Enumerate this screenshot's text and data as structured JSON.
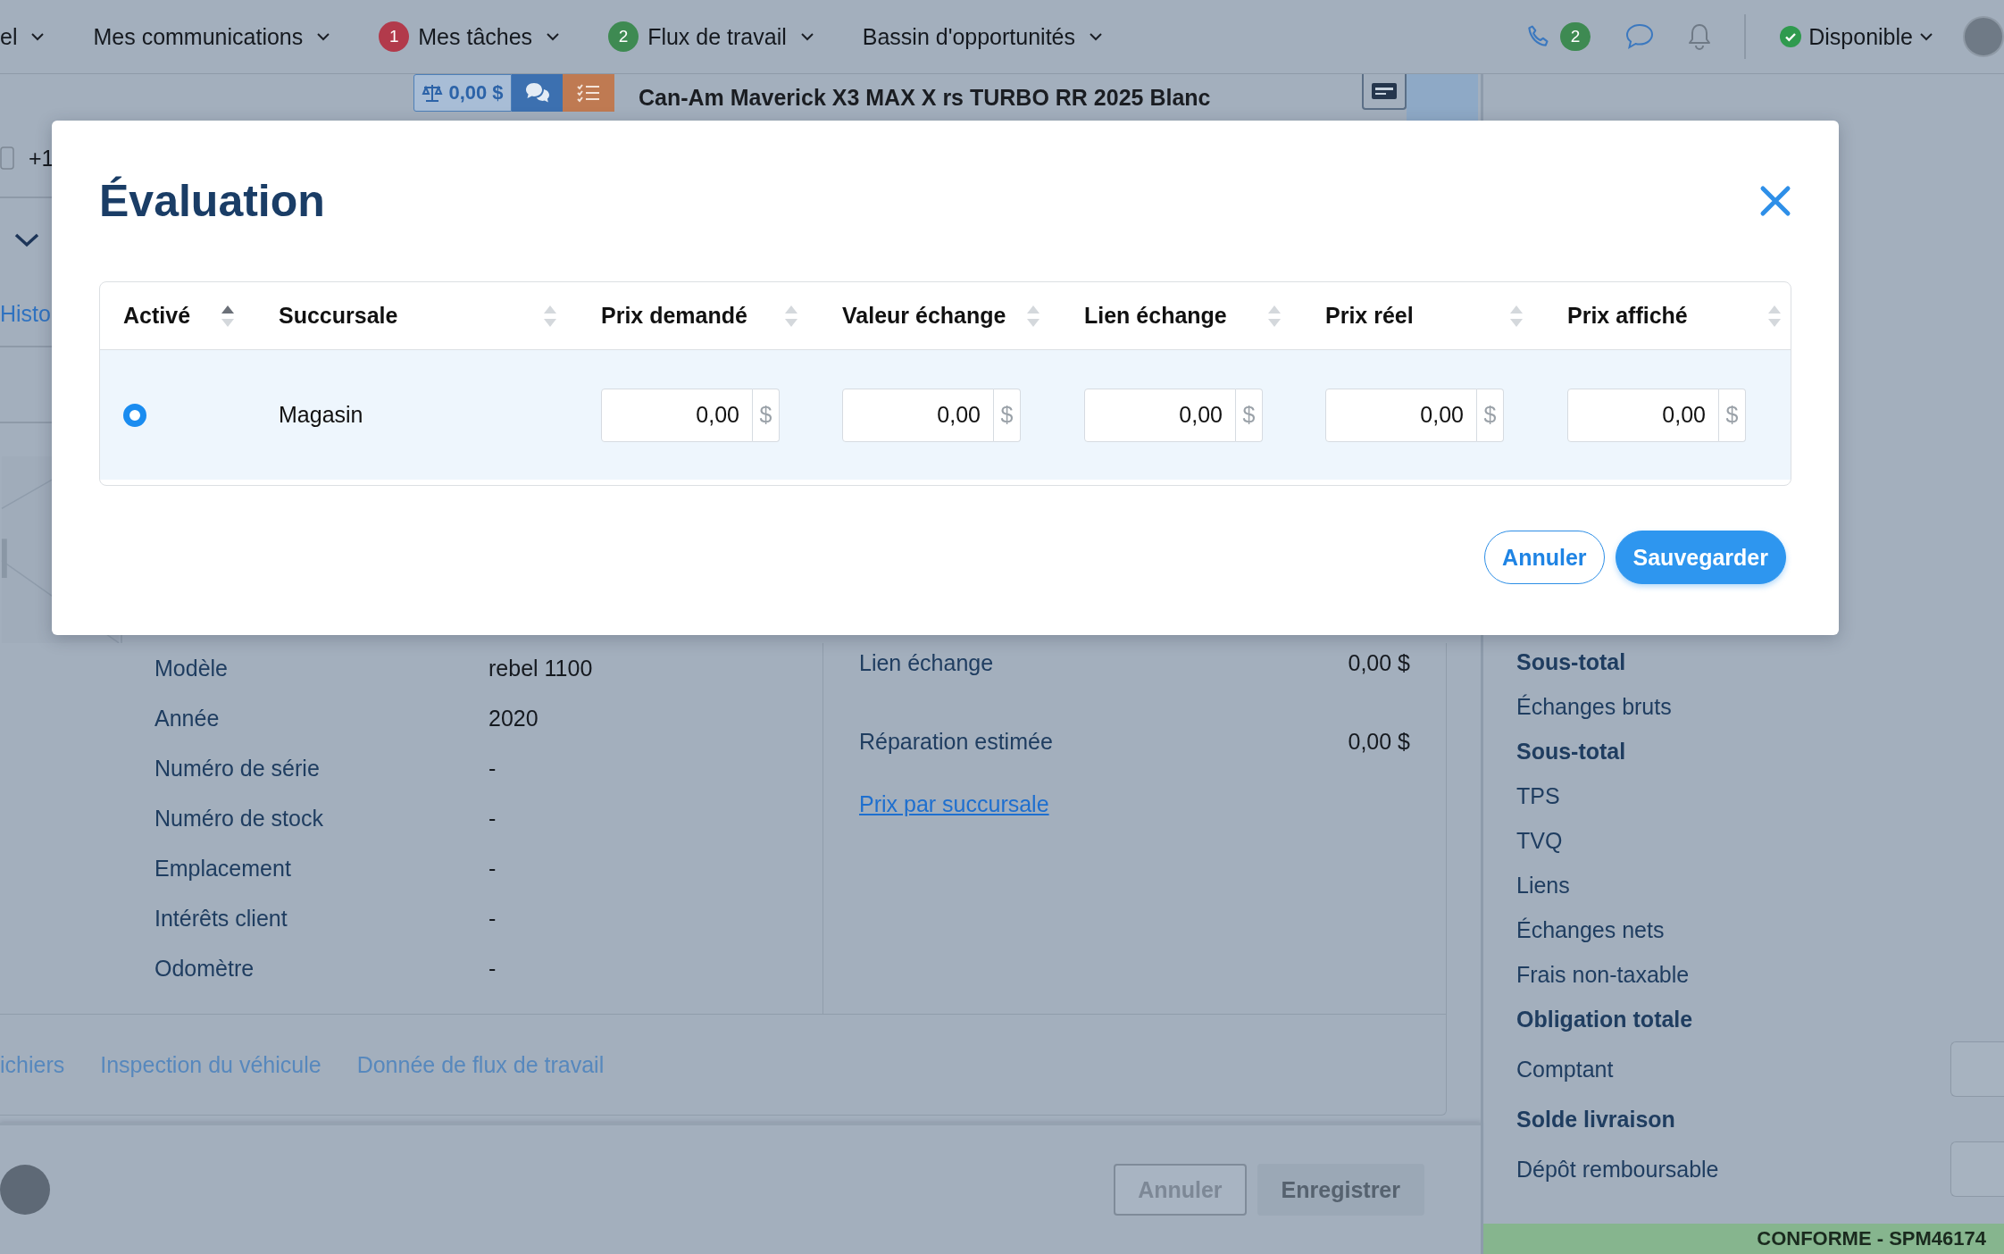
{
  "nav": {
    "items": [
      {
        "label": "el"
      },
      {
        "label": "Mes communications"
      },
      {
        "label": "Mes tâches",
        "badge": "1",
        "color": "#b23a4b"
      },
      {
        "label": "Flux de travail",
        "badge": "2",
        "color": "#3e8a52"
      },
      {
        "label": "Bassin d'opportunités"
      }
    ],
    "call_badge": "2",
    "status": "Disponible"
  },
  "toolbar": {
    "amount": "0,00 $"
  },
  "vehicle_title": "Can-Am Maverick X3 MAX X rs TURBO RR 2025 Blanc",
  "contact": {
    "phone": "+1"
  },
  "history_link": "Histo",
  "details": [
    {
      "label": "Modèle",
      "value": "rebel 1100"
    },
    {
      "label": "Année",
      "value": "2020"
    },
    {
      "label": "Numéro de série",
      "value": "-"
    },
    {
      "label": "Numéro de stock",
      "value": "-"
    },
    {
      "label": "Emplacement",
      "value": "-"
    },
    {
      "label": "Intérêts client",
      "value": "-"
    },
    {
      "label": "Odomètre",
      "value": "-"
    }
  ],
  "pricing": [
    {
      "label": "Lien échange",
      "value": "0,00 $"
    },
    {
      "label": "Réparation estimée",
      "value": "0,00 $"
    }
  ],
  "pricing_link": "Prix par succursale",
  "tabs": [
    "ichiers",
    "Inspection du véhicule",
    "Donnée de flux de travail"
  ],
  "footer_buttons": [
    {
      "label": "Annuler",
      "kind": "outline"
    },
    {
      "label": "Enregistrer",
      "kind": "filled"
    }
  ],
  "summary": [
    {
      "label": "Sous-total",
      "bold": true,
      "has_field": false
    },
    {
      "label": "Échanges bruts",
      "bold": false,
      "has_field": false
    },
    {
      "label": "Sous-total",
      "bold": true,
      "has_field": false
    },
    {
      "label": "TPS",
      "bold": false,
      "has_field": false
    },
    {
      "label": "TVQ",
      "bold": false,
      "has_field": false
    },
    {
      "label": "Liens",
      "bold": false,
      "has_field": false
    },
    {
      "label": "Échanges nets",
      "bold": false,
      "has_field": false
    },
    {
      "label": "Frais non-taxable",
      "bold": false,
      "has_field": false
    },
    {
      "label": "Obligation totale",
      "bold": true,
      "has_field": false
    },
    {
      "label": "Comptant",
      "bold": false,
      "has_field": true
    },
    {
      "label": "Solde livraison",
      "bold": true,
      "has_field": false
    },
    {
      "label": "Dépôt remboursable",
      "bold": false,
      "has_field": true
    }
  ],
  "status_banner": "CONFORME - SPM46174",
  "modal": {
    "title": "Évaluation",
    "columns": [
      {
        "label": "Activé",
        "sorted": true
      },
      {
        "label": "Succursale",
        "sorted": false
      },
      {
        "label": "Prix demandé",
        "sorted": false
      },
      {
        "label": "Valeur échange",
        "sorted": false
      },
      {
        "label": "Lien échange",
        "sorted": false
      },
      {
        "label": "Prix réel",
        "sorted": false
      },
      {
        "label": "Prix affiché",
        "sorted": false
      }
    ],
    "rows": [
      {
        "selected": true,
        "branch": "Magasin",
        "prices": [
          {
            "value": "0,00",
            "unit": "$"
          },
          {
            "value": "0,00",
            "unit": "$"
          },
          {
            "value": "0,00",
            "unit": "$"
          },
          {
            "value": "0,00",
            "unit": "$"
          },
          {
            "value": "0,00",
            "unit": "$"
          }
        ]
      }
    ],
    "buttons": [
      {
        "label": "Annuler",
        "kind": "secondary"
      },
      {
        "label": "Sauvegarder",
        "kind": "primary"
      }
    ]
  }
}
